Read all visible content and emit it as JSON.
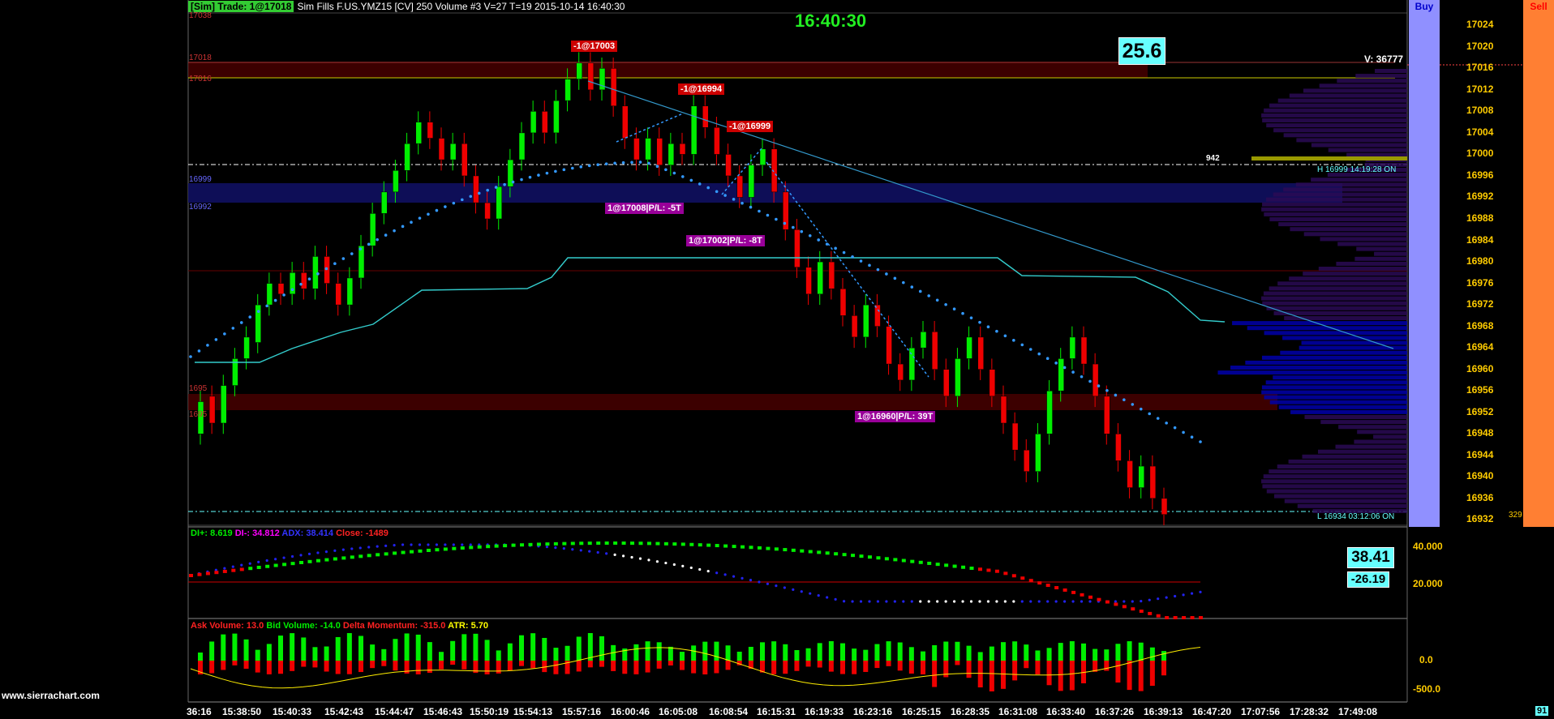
{
  "header": {
    "sim_badge": "[Sim]  Trade: 1@17018",
    "info": "Sim Fills  F.US.YMZ15 [CV]  250 Volume  #3 V=27 T=19 2015-10-14 16:40:30"
  },
  "clock": "16:40:30",
  "price_display": "25.6",
  "volume_label": "V: 36777",
  "buttons": {
    "buy": "Buy",
    "sell": "Sell"
  },
  "colors": {
    "up": "#00ee00",
    "down": "#ee0000",
    "accent": "#66ffff",
    "clock": "#22ee22",
    "buy": "#9090ff",
    "sell": "#ff7f33"
  },
  "price_axis": [
    "17024",
    "17020",
    "17016",
    "17012",
    "17008",
    "17004",
    "17000",
    "16996",
    "16992",
    "16988",
    "16984",
    "16980",
    "16976",
    "16972",
    "16968",
    "16964",
    "16960",
    "16956",
    "16952",
    "16948",
    "16944",
    "16940",
    "16936",
    "16932"
  ],
  "left_levels": [
    "17038",
    "17018",
    "17016",
    "16999",
    "16992",
    "1695",
    "1695"
  ],
  "high_label": "H 16999  14:19:28  ON",
  "low_label": "L 16934  03:12:06  ON",
  "profile_peak": "942",
  "profile_low_vol": "329",
  "axis_bottom_right": "91",
  "trade_tags": [
    {
      "text": "-1@17003",
      "style": "red"
    },
    {
      "text": "-1@16994",
      "style": "red"
    },
    {
      "text": "-1@16999",
      "style": "red"
    },
    {
      "text": "1@17008|P/L: -5T",
      "style": "mag"
    },
    {
      "text": "1@17002|P/L: -8T",
      "style": "mag"
    },
    {
      "text": "1@16960|P/L: 39T",
      "style": "mag"
    }
  ],
  "dmi": {
    "di_plus": "DI+: 8.619",
    "di_minus": "DI-: 34.812",
    "adx": "ADX: 38.414",
    "close": "Close: -1489",
    "axis": [
      "40.000",
      "20.000"
    ],
    "val1": "38.41",
    "val2": "-26.19"
  },
  "volume_panel": {
    "ask": "Ask Volume: 13.0",
    "bid": "Bid Volume: -14.0",
    "delta": "Delta Momentum: -315.0",
    "atr": "ATR: 5.70",
    "axis": [
      "0.0",
      "-500.0"
    ]
  },
  "time_axis": [
    "36:16",
    "15:38:50",
    "15:40:33",
    "15:42:43",
    "15:44:47",
    "15:46:43",
    "15:50:19",
    "15:54:13",
    "15:57:16",
    "16:00:46",
    "16:05:08",
    "16:08:54",
    "16:15:31",
    "16:19:33",
    "16:23:16",
    "16:25:15",
    "16:28:35",
    "16:31:08",
    "16:33:40",
    "16:37:26",
    "16:39:13",
    "16:47:20",
    "17:07:56",
    "17:28:32",
    "17:49:08"
  ],
  "watermark": "www.sierrachart.com",
  "chart_data": {
    "type": "candlestick",
    "symbol": "F.US.YMZ15",
    "y_axis": [
      16932,
      17024
    ],
    "bars": [
      {
        "o": 16948,
        "c": 16954
      },
      {
        "o": 16955,
        "c": 16950
      },
      {
        "o": 16950,
        "c": 16957
      },
      {
        "o": 16957,
        "c": 16962
      },
      {
        "o": 16962,
        "c": 16966
      },
      {
        "o": 16965,
        "c": 16972
      },
      {
        "o": 16972,
        "c": 16976
      },
      {
        "o": 16976,
        "c": 16974
      },
      {
        "o": 16974,
        "c": 16978
      },
      {
        "o": 16978,
        "c": 16975
      },
      {
        "o": 16975,
        "c": 16981
      },
      {
        "o": 16981,
        "c": 16976
      },
      {
        "o": 16976,
        "c": 16972
      },
      {
        "o": 16972,
        "c": 16977
      },
      {
        "o": 16977,
        "c": 16983
      },
      {
        "o": 16983,
        "c": 16989
      },
      {
        "o": 16989,
        "c": 16993
      },
      {
        "o": 16993,
        "c": 16997
      },
      {
        "o": 16997,
        "c": 17002
      },
      {
        "o": 17002,
        "c": 17006
      },
      {
        "o": 17006,
        "c": 17003
      },
      {
        "o": 17003,
        "c": 16999
      },
      {
        "o": 16999,
        "c": 17002
      },
      {
        "o": 17002,
        "c": 16996
      },
      {
        "o": 16996,
        "c": 16991
      },
      {
        "o": 16991,
        "c": 16988
      },
      {
        "o": 16988,
        "c": 16994
      },
      {
        "o": 16994,
        "c": 16999
      },
      {
        "o": 16999,
        "c": 17004
      },
      {
        "o": 17004,
        "c": 17008
      },
      {
        "o": 17008,
        "c": 17004
      },
      {
        "o": 17004,
        "c": 17010
      },
      {
        "o": 17010,
        "c": 17014
      },
      {
        "o": 17014,
        "c": 17017
      },
      {
        "o": 17017,
        "c": 17012
      },
      {
        "o": 17012,
        "c": 17016
      },
      {
        "o": 17016,
        "c": 17009
      },
      {
        "o": 17009,
        "c": 17003
      },
      {
        "o": 17003,
        "c": 16999
      },
      {
        "o": 16999,
        "c": 17003
      },
      {
        "o": 17003,
        "c": 16998
      },
      {
        "o": 16998,
        "c": 17002
      },
      {
        "o": 17002,
        "c": 17000
      },
      {
        "o": 17000,
        "c": 17009
      },
      {
        "o": 17009,
        "c": 17005
      },
      {
        "o": 17005,
        "c": 17000
      },
      {
        "o": 17000,
        "c": 16996
      },
      {
        "o": 16996,
        "c": 16992
      },
      {
        "o": 16992,
        "c": 16998
      },
      {
        "o": 16998,
        "c": 17001
      },
      {
        "o": 17001,
        "c": 16993
      },
      {
        "o": 16993,
        "c": 16986
      },
      {
        "o": 16986,
        "c": 16979
      },
      {
        "o": 16979,
        "c": 16974
      },
      {
        "o": 16974,
        "c": 16980
      },
      {
        "o": 16980,
        "c": 16975
      },
      {
        "o": 16975,
        "c": 16970
      },
      {
        "o": 16970,
        "c": 16966
      },
      {
        "o": 16966,
        "c": 16972
      },
      {
        "o": 16972,
        "c": 16968
      },
      {
        "o": 16968,
        "c": 16961
      },
      {
        "o": 16961,
        "c": 16958
      },
      {
        "o": 16958,
        "c": 16964
      },
      {
        "o": 16964,
        "c": 16967
      },
      {
        "o": 16967,
        "c": 16960
      },
      {
        "o": 16960,
        "c": 16955
      },
      {
        "o": 16955,
        "c": 16962
      },
      {
        "o": 16962,
        "c": 16966
      },
      {
        "o": 16966,
        "c": 16960
      },
      {
        "o": 16960,
        "c": 16955
      },
      {
        "o": 16955,
        "c": 16950
      },
      {
        "o": 16950,
        "c": 16945
      },
      {
        "o": 16945,
        "c": 16941
      },
      {
        "o": 16941,
        "c": 16948
      },
      {
        "o": 16948,
        "c": 16956
      },
      {
        "o": 16956,
        "c": 16962
      },
      {
        "o": 16962,
        "c": 16966
      },
      {
        "o": 16966,
        "c": 16961
      },
      {
        "o": 16961,
        "c": 16955
      },
      {
        "o": 16955,
        "c": 16948
      },
      {
        "o": 16948,
        "c": 16943
      },
      {
        "o": 16943,
        "c": 16938
      },
      {
        "o": 16938,
        "c": 16942
      },
      {
        "o": 16942,
        "c": 16936
      },
      {
        "o": 16936,
        "c": 16933
      }
    ]
  }
}
